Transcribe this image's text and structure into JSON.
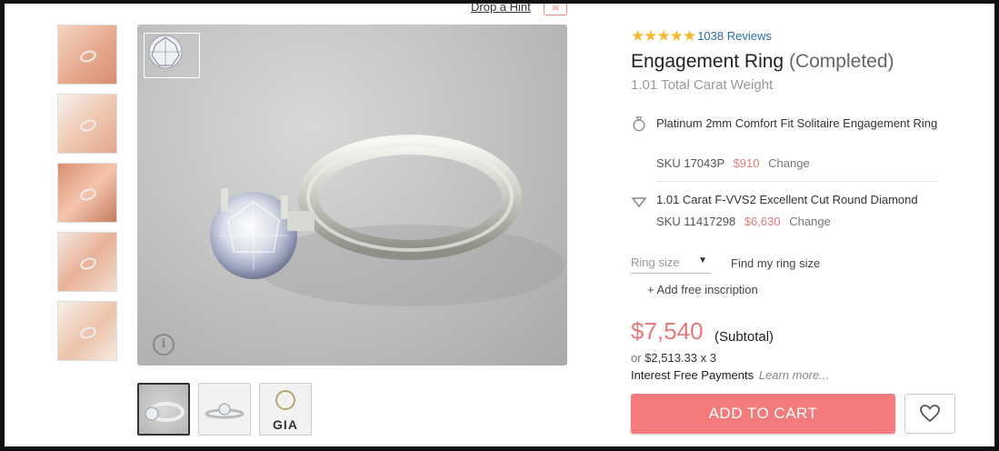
{
  "header": {
    "drop_hint_label": "Drop a Hint"
  },
  "gallery": {
    "thumbnails": [
      "hand-1",
      "hand-2",
      "hand-3",
      "hand-4",
      "hand-5"
    ],
    "views": [
      "ring-side-view",
      "ring-front-view",
      "gia-certificate"
    ],
    "gia_label": "GIA"
  },
  "product": {
    "stars": "★★★★★",
    "reviews": "1038 Reviews",
    "title": "Engagement Ring",
    "title_status": "(Completed)",
    "carat_weight": "1.01 Total Carat Weight",
    "setting": {
      "name": "Platinum 2mm Comfort Fit Solitaire Engagement Ring",
      "sku": "SKU 17043P",
      "price": "$910",
      "change": "Change"
    },
    "diamond": {
      "name": "1.01 Carat F-VVS2 Excellent Cut Round Diamond",
      "sku": "SKU 11417298",
      "price": "$6,630",
      "change": "Change"
    }
  },
  "options": {
    "ring_size_placeholder": "Ring size",
    "find_size": "Find my ring size",
    "inscription": "+ Add free inscription"
  },
  "pricing": {
    "total": "$7,540",
    "subtotal_label": "(Subtotal)",
    "or_label": "or",
    "installment": "$2,513.33 x 3",
    "interest_label": "Interest Free Payments",
    "learn_more": "Learn more..."
  },
  "actions": {
    "add_to_cart": "ADD TO CART"
  },
  "colors": {
    "accent": "#f47b7b",
    "price": "#e47a7a",
    "star": "#f5b82e",
    "link": "#2b6ca3"
  }
}
